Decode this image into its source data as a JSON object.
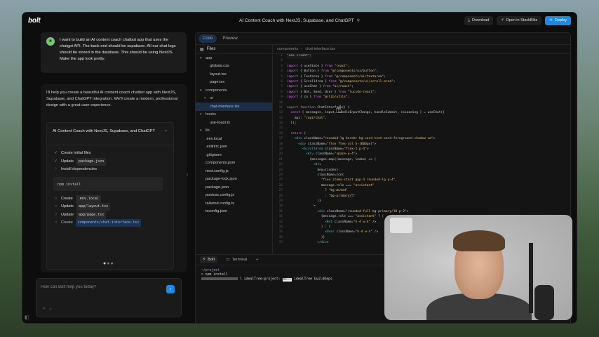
{
  "app": {
    "logo": "bolt",
    "title": "AI Content Coach with NextJS, Supabase, and ChatGPT"
  },
  "toolbar": {
    "download": "Download",
    "stackblitz": "Open in StackBlitz",
    "deploy": "Deploy"
  },
  "chat": {
    "user_message": "I want to build an AI content coach chatbot app that uses the chatgpt API. The back end should be supabase. All our chat logs should be stored in the database. This should be using NextJS. Make the app look pretty.",
    "assistant_message": "I'll help you create a beautiful AI content coach chatbot app with NextJS, Supabase, and ChatGPT integration. We'll create a modern, professional design with a great user experience.",
    "artifact_title": "AI Content Coach with NextJS, Supabase, and ChatGPT",
    "steps": [
      {
        "status": "done",
        "text": "Create initial files",
        "code": ""
      },
      {
        "status": "done",
        "text": "Update",
        "code": "package.json"
      },
      {
        "status": "running",
        "text": "Install dependencies",
        "code": ""
      },
      {
        "status": "todo",
        "text": "Create",
        "code": ".env.local"
      },
      {
        "status": "todo",
        "text": "Update",
        "code": "app/layout.tsx"
      },
      {
        "status": "todo",
        "text": "Update",
        "code": "app/page.tsx"
      },
      {
        "status": "todo",
        "text": "Create",
        "code": "components/chat-interface.tsx"
      }
    ],
    "install_cmd_prefix": "npm",
    "install_cmd": "install",
    "input_placeholder": "How can Bolt help you today?"
  },
  "workbench": {
    "tabs": [
      "Code",
      "Preview"
    ],
    "files_label": "Files",
    "breadcrumb": [
      "components",
      "chat-interface.tsx"
    ],
    "tree": [
      {
        "name": "app",
        "type": "folder",
        "depth": 0
      },
      {
        "name": "globals.css",
        "type": "file",
        "depth": 1
      },
      {
        "name": "layout.tsx",
        "type": "file",
        "depth": 1
      },
      {
        "name": "page.tsx",
        "type": "file",
        "depth": 1
      },
      {
        "name": "components",
        "type": "folder",
        "depth": 0
      },
      {
        "name": "ui",
        "type": "folder",
        "depth": 1
      },
      {
        "name": "chat-interface.tsx",
        "type": "file",
        "depth": 1,
        "selected": true
      },
      {
        "name": "hooks",
        "type": "folder",
        "depth": 0
      },
      {
        "name": "use-toast.ts",
        "type": "file",
        "depth": 1
      },
      {
        "name": "lib",
        "type": "folder",
        "depth": 0
      },
      {
        "name": ".env.local",
        "type": "file",
        "depth": 0
      },
      {
        "name": ".eslintrc.json",
        "type": "file",
        "depth": 0
      },
      {
        "name": ".gitignore",
        "type": "file",
        "depth": 0
      },
      {
        "name": "components.json",
        "type": "file",
        "depth": 0
      },
      {
        "name": "next.config.js",
        "type": "file",
        "depth": 0
      },
      {
        "name": "package-lock.json",
        "type": "file",
        "depth": 0
      },
      {
        "name": "package.json",
        "type": "file",
        "depth": 0
      },
      {
        "name": "postcss.config.js",
        "type": "file",
        "depth": 0
      },
      {
        "name": "tailwind.config.ts",
        "type": "file",
        "depth": 0
      },
      {
        "name": "tsconfig.json",
        "type": "file",
        "depth": 0
      }
    ],
    "code_lines": [
      "\"use client\";",
      "",
      "import { useState } from \"react\";",
      "import { Button } from \"@/components/ui/button\";",
      "import { Textarea } from \"@/components/ui/textarea\";",
      "import { ScrollArea } from \"@/components/ui/scroll-area\";",
      "import { useChat } from \"ai/react\";",
      "import { Bot, Send, User } from \"lucide-react\";",
      "import { cn } from \"@/lib/utils\";",
      "",
      "export function ChatInterface() {",
      "  const { messages, input, handleInputChange, handleSubmit, isLoading } = useChat({",
      "    api: \"/api/chat\",",
      "  });",
      "",
      "  return (",
      "    <div className=\"rounded-lg border bg-card text-card-foreground shadow-sm\">",
      "      <div className=\"flex flex-col h-[600px]\">",
      "        <ScrollArea className=\"flex-1 p-4\">",
      "          <div className=\"space-y-4\">",
      "            {messages.map((message, index) => (",
      "              <div",
      "                key={index}",
      "                className={cn(",
      "                  \"flex items-start gap-4 rounded-lg p-4\",",
      "                  message.role === \"assistant\"",
      "                    ? \"bg-muted\"",
      "                    : \"bg-primary/5\"",
      "                )}",
      "              >",
      "                <div className=\"rounded-full bg-primary/10 p-2\">",
      "                  {message.role === \"assistant\" ? (",
      "                    <Bot className=\"h-4 w-4\" />",
      "                  ) : (",
      "                    <User className=\"h-4 w-4\" />",
      "                  )}",
      "                </div>"
    ],
    "terminal_tabs": [
      "Bolt",
      "Terminal"
    ],
    "terminal_path": "~/project",
    "terminal_cmd": "> npm install",
    "terminal_progress": "\\ idealTree:project:",
    "terminal_highlight": "sill",
    "terminal_tail": "idealTree buildDeps"
  },
  "icons": {
    "avatar": "leaf-icon",
    "send": "arrow-up-icon",
    "chevron": "chevron-up-icon"
  },
  "colors": {
    "accent": "#1e88e5",
    "success": "#4caf50"
  }
}
